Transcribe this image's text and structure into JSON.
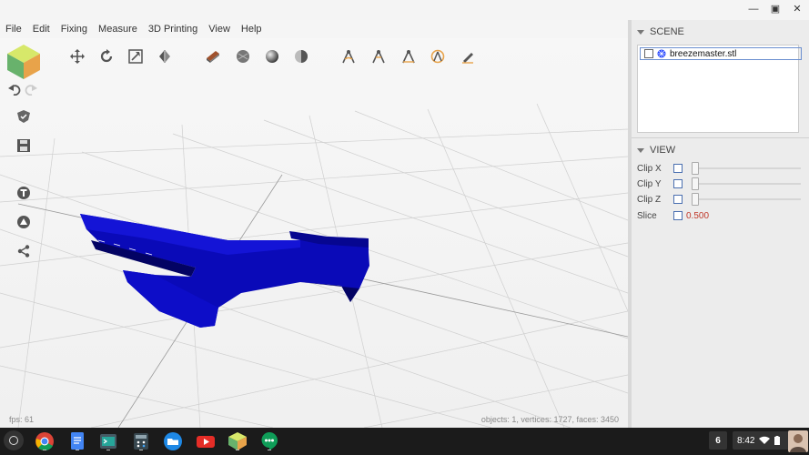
{
  "window": {
    "minimize": "—",
    "restore": "▣",
    "close": "✕"
  },
  "menu": [
    "File",
    "Edit",
    "Fixing",
    "Measure",
    "3D Printing",
    "View",
    "Help"
  ],
  "toolbar_top": [
    "move-icon",
    "rotate-icon",
    "scale-icon",
    "mirror-icon",
    "layer-icon",
    "sphere-smooth-icon",
    "sphere-shade-icon",
    "sphere-half-icon",
    "measure-compass-icon",
    "measure-angle-icon",
    "measure-ruler-icon",
    "measure-circle-icon",
    "pencil-icon"
  ],
  "toolbar_left": [
    "view-cube-icon",
    "undo-icon",
    "redo-icon",
    "shield-icon",
    "save-icon",
    "text-icon",
    "drive-icon",
    "share-icon"
  ],
  "status": {
    "fps": "fps: 61",
    "objects": "objects: 1, vertices: 1727, faces: 3450"
  },
  "scene": {
    "title": "SCENE",
    "items": [
      {
        "name": "breezemaster.stl"
      }
    ]
  },
  "view": {
    "title": "VIEW",
    "clip_x": "Clip X",
    "clip_y": "Clip Y",
    "clip_z": "Clip Z",
    "slice_label": "Slice",
    "slice_value": "0.500"
  },
  "colors": {
    "model": "#0a0ab8",
    "model_dark": "#030363",
    "accent": "#6b8fd0"
  },
  "taskbar": {
    "apps": [
      "chrome-icon",
      "docs-icon",
      "terminal-icon",
      "calculator-icon",
      "files-icon",
      "youtube-icon",
      "3d-viewer-icon",
      "hangouts-icon"
    ],
    "notifications": "6",
    "time": "8:42"
  }
}
